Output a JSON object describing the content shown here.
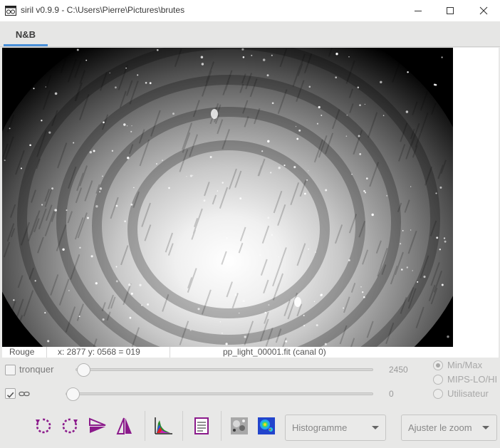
{
  "window": {
    "title": "siril v0.9.9 - C:\\Users\\Pierre\\Pictures\\brutes"
  },
  "tabs": [
    {
      "label": "N&B",
      "active": true
    }
  ],
  "statusbar": {
    "channel": "Rouge",
    "coords": "x: 2877 y: 0568 = 019",
    "file": "pp_light_00001.fit (canal 0)"
  },
  "controls": {
    "clip_label": "tronquer",
    "clip_checked": false,
    "high_value": "2450",
    "link_checked": true,
    "low_value": "0",
    "scale_modes": [
      {
        "label": "Min/Max",
        "selected": true
      },
      {
        "label": "MIPS-LO/HI",
        "selected": false
      },
      {
        "label": "Utilisateur",
        "selected": false
      }
    ]
  },
  "toolbar": {
    "display_mode": "Histogramme",
    "zoom_mode": "Ajuster le zoom"
  },
  "colors": {
    "accent": "#4a90d9",
    "icon_purple": "#8b1a8b"
  }
}
